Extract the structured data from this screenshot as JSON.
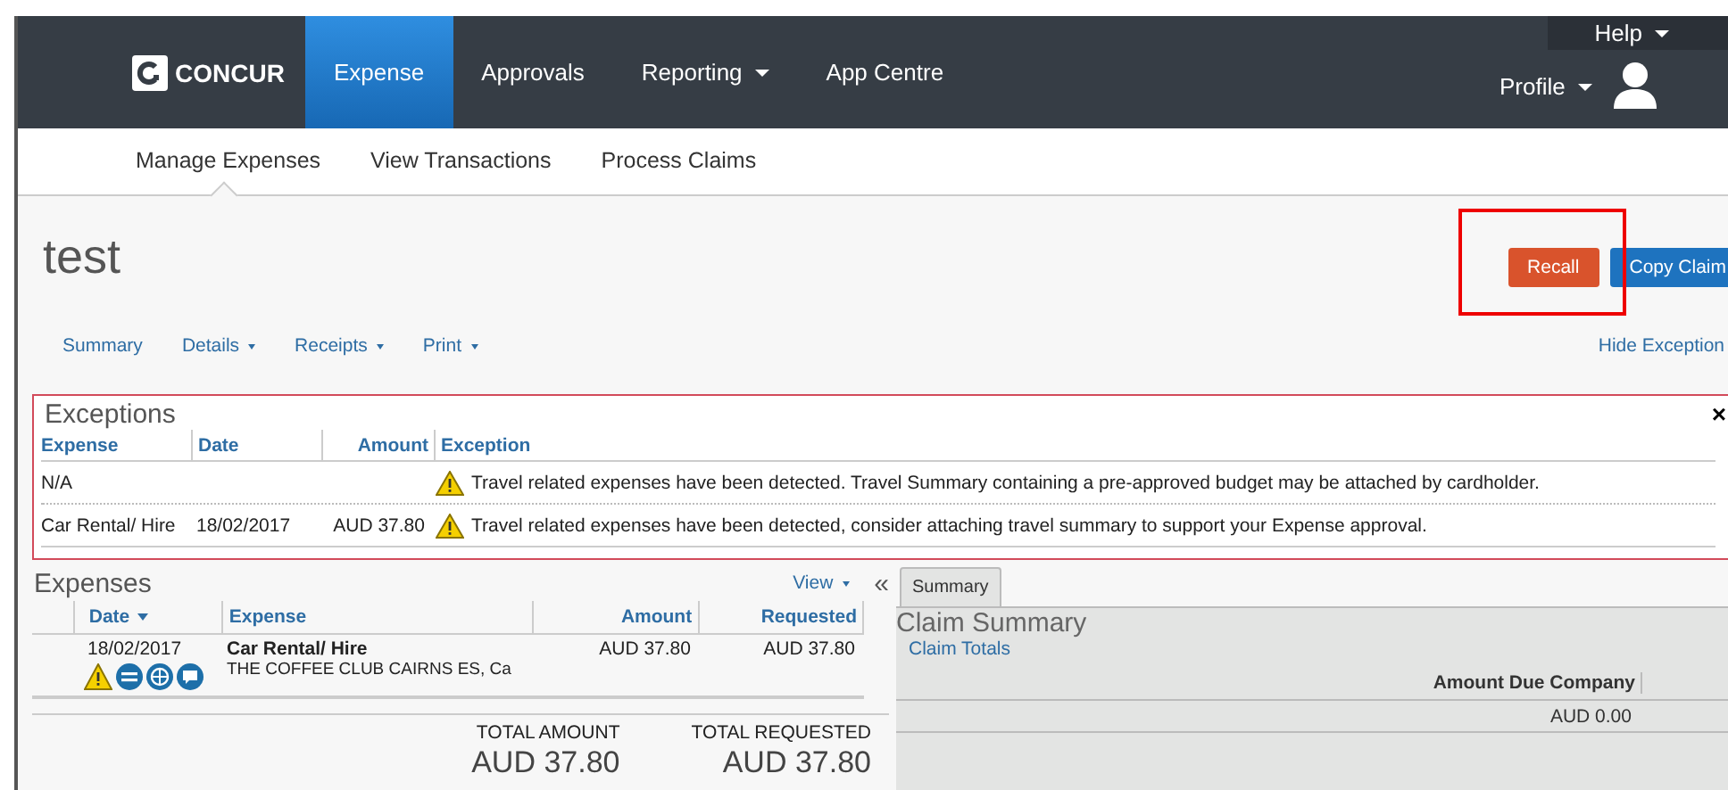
{
  "header": {
    "logo": "CONCUR",
    "nav": [
      {
        "label": "Expense",
        "selected": true,
        "has_menu": false
      },
      {
        "label": "Approvals",
        "selected": false,
        "has_menu": false
      },
      {
        "label": "Reporting",
        "selected": false,
        "has_menu": true
      },
      {
        "label": "App Centre",
        "selected": false,
        "has_menu": false
      }
    ],
    "help": "Help",
    "profile": "Profile"
  },
  "subnav": [
    {
      "label": "Manage Expenses",
      "selected": true
    },
    {
      "label": "View Transactions",
      "selected": false
    },
    {
      "label": "Process Claims",
      "selected": false
    }
  ],
  "report": {
    "title": "test",
    "buttons": [
      {
        "label": "Recall",
        "kind": "danger",
        "highlighted": true
      },
      {
        "label": "Copy Claim",
        "kind": "primary",
        "highlighted": false
      }
    ],
    "menu": [
      {
        "label": "Summary",
        "has_menu": false
      },
      {
        "label": "Details",
        "has_menu": true
      },
      {
        "label": "Receipts",
        "has_menu": true
      },
      {
        "label": "Print",
        "has_menu": true
      }
    ],
    "hide_exceptions": "Hide Exception"
  },
  "exceptions": {
    "title": "Exceptions",
    "close": "×",
    "columns": [
      "Expense",
      "Date",
      "Amount",
      "Exception"
    ],
    "rows": [
      {
        "expense": "N/A",
        "date": "",
        "amount": "",
        "message": "Travel related expenses have been detected. Travel Summary containing a pre-approved budget may be attached by cardholder."
      },
      {
        "expense": "Car Rental/ Hire",
        "date": "18/02/2017",
        "amount": "AUD 37.80",
        "message": "Travel related expenses have been detected, consider attaching travel summary to support your Expense approval."
      }
    ]
  },
  "expenses": {
    "title": "Expenses",
    "view": "View",
    "collapse": "«",
    "columns": [
      {
        "label": "Date",
        "sorted": true
      },
      {
        "label": "Expense",
        "sorted": false
      },
      {
        "label": "Amount",
        "sorted": false
      },
      {
        "label": "Requested",
        "sorted": false
      }
    ],
    "rows": [
      {
        "date": "18/02/2017",
        "expense": "Car Rental/ Hire",
        "vendor": "THE COFFEE CLUB CAIRNS ES, Ca",
        "amount": "AUD 37.80",
        "requested": "AUD 37.80"
      }
    ],
    "totals": [
      {
        "label": "TOTAL AMOUNT",
        "value": "AUD 37.80"
      },
      {
        "label": "TOTAL REQUESTED",
        "value": "AUD 37.80"
      }
    ]
  },
  "summary": {
    "tabs": [
      {
        "label": "Summary",
        "selected": true
      }
    ],
    "title": "Claim Summary",
    "section": "Claim Totals",
    "column": "Amount Due Company",
    "value": "AUD 0.00"
  }
}
